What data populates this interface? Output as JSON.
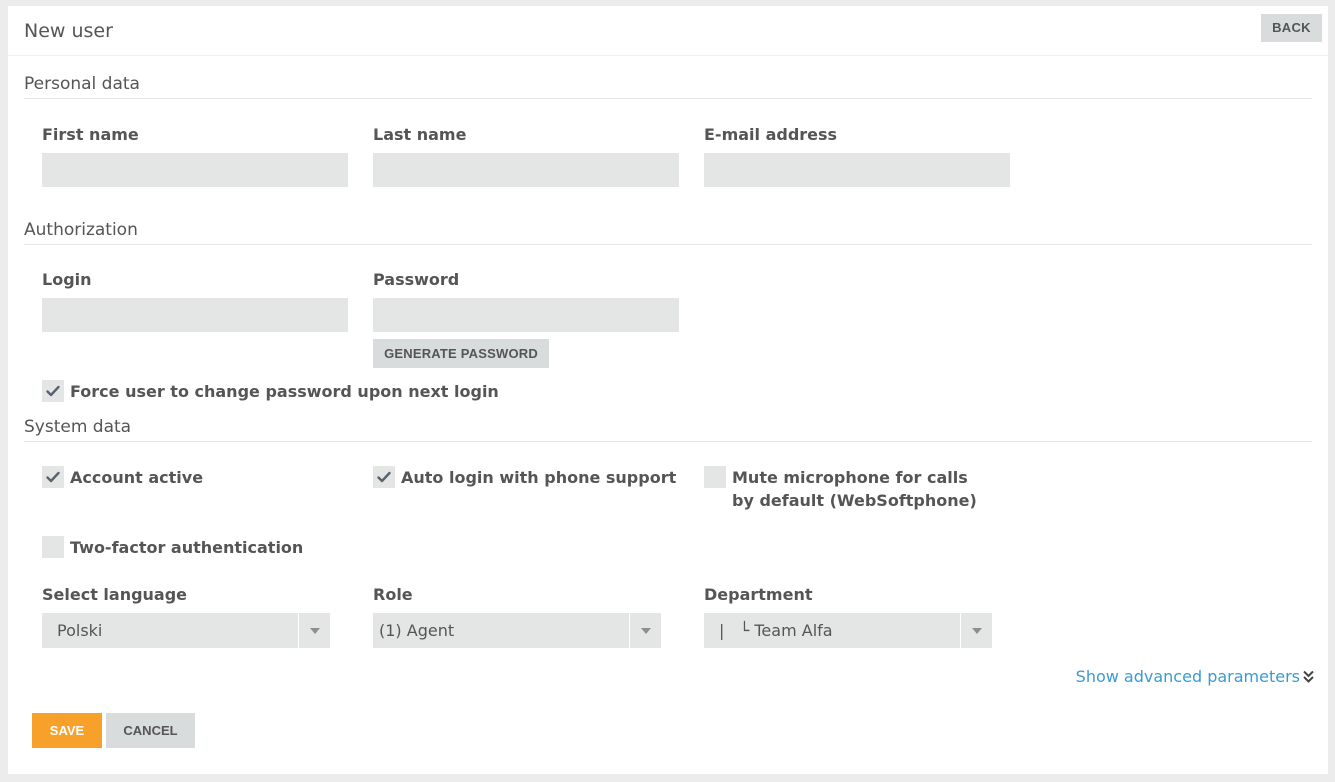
{
  "header": {
    "title": "New user",
    "back_label": "BACK"
  },
  "personal": {
    "section_title": "Personal data",
    "first_name_label": "First name",
    "first_name_value": "",
    "last_name_label": "Last name",
    "last_name_value": "",
    "email_label": "E-mail address",
    "email_value": ""
  },
  "authorization": {
    "section_title": "Authorization",
    "login_label": "Login",
    "login_value": "",
    "password_label": "Password",
    "password_value": "",
    "generate_label": "GENERATE PASSWORD",
    "force_change_label": "Force user to change password upon next login",
    "force_change_checked": true
  },
  "system": {
    "section_title": "System data",
    "account_active_label": "Account active",
    "account_active_checked": true,
    "auto_login_label": "Auto login with phone support",
    "auto_login_checked": true,
    "mute_mic_label": "Mute microphone for calls by default (WebSoftphone)",
    "mute_mic_checked": false,
    "two_factor_label": "Two-factor authentication",
    "two_factor_checked": false,
    "language_label": "Select language",
    "language_value": "Polski",
    "role_label": "Role",
    "role_value": "(1) Agent",
    "department_label": "Department",
    "department_value": "|   └ Team Alfa"
  },
  "advanced_link": "Show advanced parameters",
  "actions": {
    "save_label": "SAVE",
    "cancel_label": "CANCEL"
  },
  "icons": {
    "checkmark": "check-icon",
    "dropdown": "caret-down-icon",
    "advanced": "double-chevron-down-icon"
  },
  "colors": {
    "accent_save": "#f7a12a",
    "link": "#3a9bd1",
    "field_bg": "#e4e6e6",
    "button_gray": "#d9dcdc"
  }
}
